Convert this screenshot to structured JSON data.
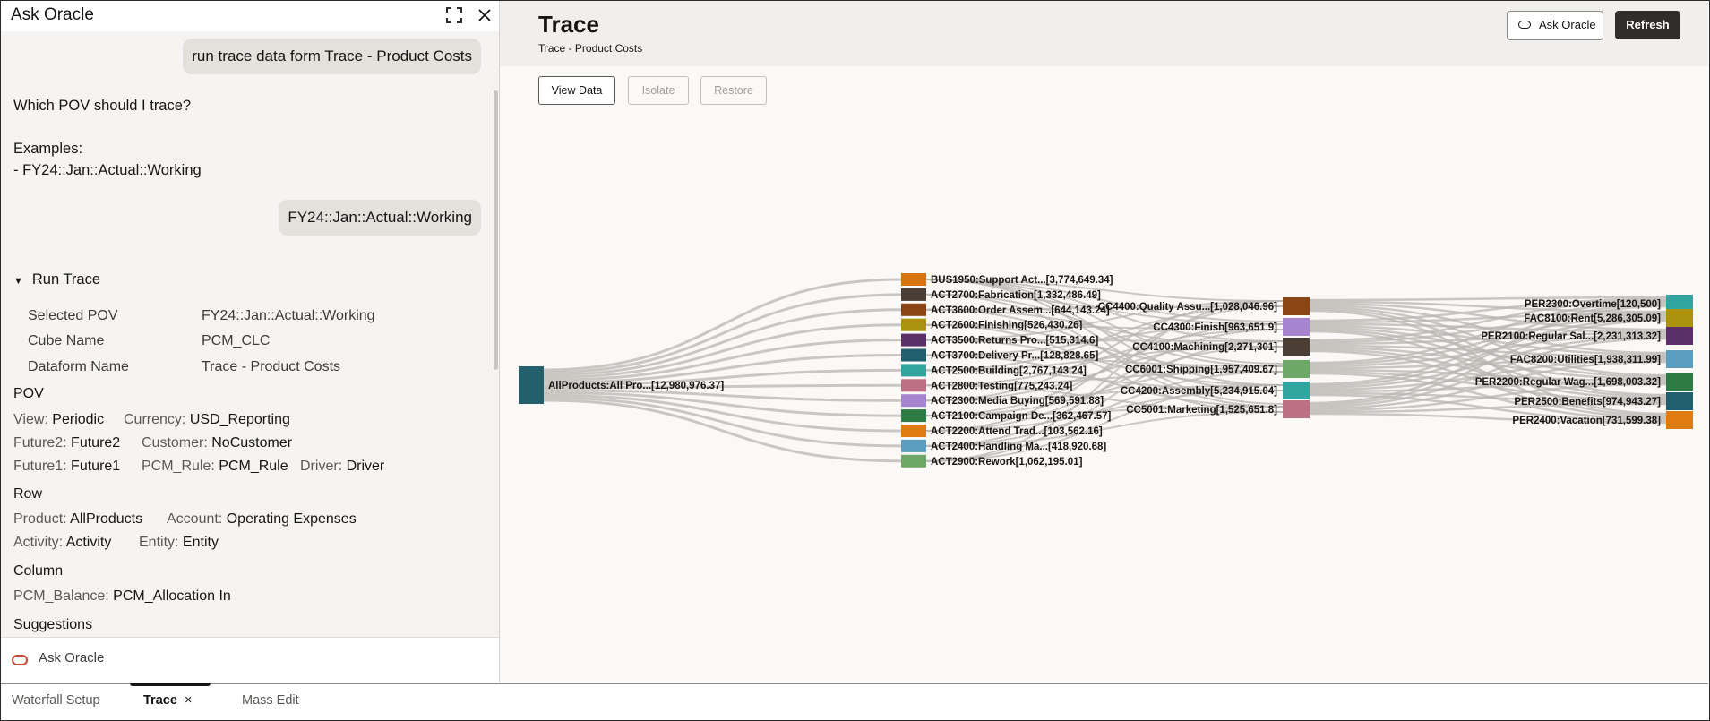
{
  "panel": {
    "title": "Ask Oracle",
    "messages": {
      "user1": "run trace data form Trace - Product Costs",
      "bot_q": "Which POV should I trace?",
      "bot_ex_label": "Examples:",
      "bot_ex_item": "- FY24::Jan::Actual::Working",
      "user2": "FY24::Jan::Actual::Working"
    },
    "run_trace": {
      "heading": "Run Trace",
      "rows": [
        {
          "label": "Selected POV",
          "value": "FY24::Jan::Actual::Working"
        },
        {
          "label": "Cube Name",
          "value": "PCM_CLC"
        },
        {
          "label": "Dataform Name",
          "value": "Trace - Product Costs"
        }
      ]
    },
    "pov_heading": "POV",
    "pov": {
      "view_label": "View:",
      "view": "Periodic",
      "currency_label": "Currency:",
      "currency": "USD_Reporting",
      "future2_label": "Future2:",
      "future2": "Future2",
      "customer_label": "Customer:",
      "customer": "NoCustomer",
      "future1_label": "Future1:",
      "future1": "Future1",
      "rule_label": "PCM_Rule:",
      "rule": "PCM_Rule",
      "driver_label": "Driver:",
      "driver": "Driver"
    },
    "row_heading": "Row",
    "row": {
      "product_label": "Product:",
      "product": "AllProducts",
      "account_label": "Account:",
      "account": "Operating Expenses",
      "activity_label": "Activity:",
      "activity": "Activity",
      "entity_label": "Entity:",
      "entity": "Entity"
    },
    "column_heading": "Column",
    "column": {
      "balance_label": "PCM_Balance:",
      "balance": "PCM_Allocation In"
    },
    "suggestions_heading": "Suggestions",
    "ask_placeholder": "Ask Oracle"
  },
  "main": {
    "title": "Trace",
    "subtitle": "Trace - Product Costs",
    "ask_button": "Ask Oracle",
    "refresh_button": "Refresh",
    "toolbar": {
      "view_data": "View Data",
      "isolate": "Isolate",
      "restore": "Restore"
    }
  },
  "tabs": [
    {
      "label": "Waterfall Setup"
    },
    {
      "label": "Trace",
      "close": "×"
    },
    {
      "label": "Mass Edit"
    }
  ],
  "chart_data": {
    "type": "sankey",
    "nodes": {
      "source": [
        {
          "label": "AllProducts:All Pro...[12,980,976.37]",
          "color": "#24606b"
        }
      ],
      "level1": [
        {
          "label": "BUS1950:Support Act...[3,774,649.34]",
          "color": "#d7740f"
        },
        {
          "label": "ACT2700:Fabrication[1,332,486.49]",
          "color": "#4a3e35"
        },
        {
          "label": "ACT3600:Order Assem...[644,143.24]",
          "color": "#8a4416"
        },
        {
          "label": "ACT2600:Finishing[526,430.26]",
          "color": "#ab9310"
        },
        {
          "label": "ACT3500:Returns Pro...[515,314.6]",
          "color": "#5b2f68"
        },
        {
          "label": "ACT3700:Delivery Pr...[128,828.65]",
          "color": "#215e6e"
        },
        {
          "label": "ACT2500:Building[2,767,143.24]",
          "color": "#31a6a0"
        },
        {
          "label": "ACT2800:Testing[775,243.24]",
          "color": "#bd6f83"
        },
        {
          "label": "ACT2300:Media Buying[569,591.88]",
          "color": "#a684d0"
        },
        {
          "label": "ACT2100:Campaign De...[362,467.57]",
          "color": "#2f7b45"
        },
        {
          "label": "ACT2200:Attend Trad...[103,562.16]",
          "color": "#de7c12"
        },
        {
          "label": "ACT2400:Handling Ma...[418,920.68]",
          "color": "#5b9ebf"
        },
        {
          "label": "ACT2900:Rework[1,062,195.01]",
          "color": "#6ea868"
        }
      ],
      "level2": [
        {
          "label": "CC4400:Quality Assu...[1,028,046.96]",
          "color": "#8a4416"
        },
        {
          "label": "CC4300:Finish[963,651.9]",
          "color": "#a684d0"
        },
        {
          "label": "CC4100:Machining[2,271,301]",
          "color": "#4a3e35"
        },
        {
          "label": "CC6001:Shipping[1,957,409.67]",
          "color": "#6ea868"
        },
        {
          "label": "CC4200:Assembly[5,234,915.04]",
          "color": "#31a6a0"
        },
        {
          "label": "CC5001:Marketing[1,525,651.8]",
          "color": "#bd6f83"
        }
      ],
      "level3": [
        {
          "label": "PER2300:Overtime[120,500]",
          "color": "#31a6a0"
        },
        {
          "label": "FAC8100:Rent[5,286,305.09]",
          "color": "#ab9310"
        },
        {
          "label": "PER2100:Regular Sal...[2,231,313.32]",
          "color": "#5b2f68"
        },
        {
          "label": "FAC8200:Utilities[1,938,311.99]",
          "color": "#5b9ebf"
        },
        {
          "label": "PER2200:Regular Wag...[1,698,003.32]",
          "color": "#2f7b45"
        },
        {
          "label": "PER2500:Benefits[974,943.27]",
          "color": "#215e6e"
        },
        {
          "label": "PER2400:Vacation[731,599.38]",
          "color": "#de7c12"
        }
      ]
    },
    "link_color": "#b9b6b2"
  }
}
